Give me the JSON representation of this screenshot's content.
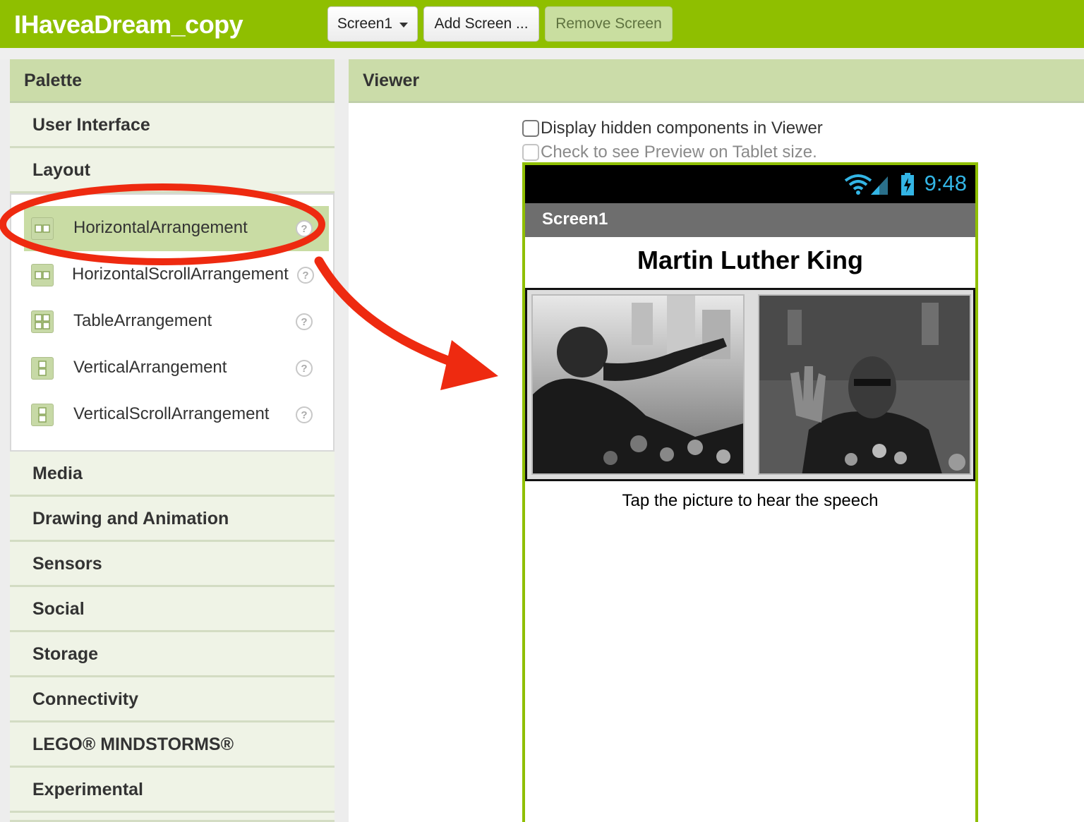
{
  "app": {
    "title": "IHaveaDream_copy"
  },
  "toolbar": {
    "screen_select": "Screen1",
    "add_screen": "Add Screen ...",
    "remove_screen": "Remove Screen"
  },
  "palette": {
    "title": "Palette",
    "categories": {
      "user_interface": "User Interface",
      "layout": "Layout",
      "media": "Media",
      "drawing": "Drawing and Animation",
      "sensors": "Sensors",
      "social": "Social",
      "storage": "Storage",
      "connectivity": "Connectivity",
      "lego": "LEGO® MINDSTORMS®",
      "experimental": "Experimental"
    },
    "layout_items": [
      {
        "label": "HorizontalArrangement",
        "icon": "horizontal-arrangement-icon",
        "selected": true
      },
      {
        "label": "HorizontalScrollArrangement",
        "icon": "horizontal-scroll-arrangement-icon"
      },
      {
        "label": "TableArrangement",
        "icon": "table-arrangement-icon"
      },
      {
        "label": "VerticalArrangement",
        "icon": "vertical-arrangement-icon"
      },
      {
        "label": "VerticalScrollArrangement",
        "icon": "vertical-scroll-arrangement-icon"
      }
    ],
    "help_glyph": "?"
  },
  "viewer": {
    "title": "Viewer",
    "hidden_components_label": "Display hidden components in Viewer",
    "tablet_preview_label": "Check to see Preview on Tablet size."
  },
  "phone": {
    "time": "9:48",
    "screen_title": "Screen1",
    "heading": "Martin Luther King",
    "caption": "Tap the picture to hear the speech"
  },
  "colors": {
    "brand_green": "#8fbf00",
    "panel_header": "#cbdca9",
    "annotation_red": "#ee2a10",
    "status_blue": "#33b5e5"
  }
}
